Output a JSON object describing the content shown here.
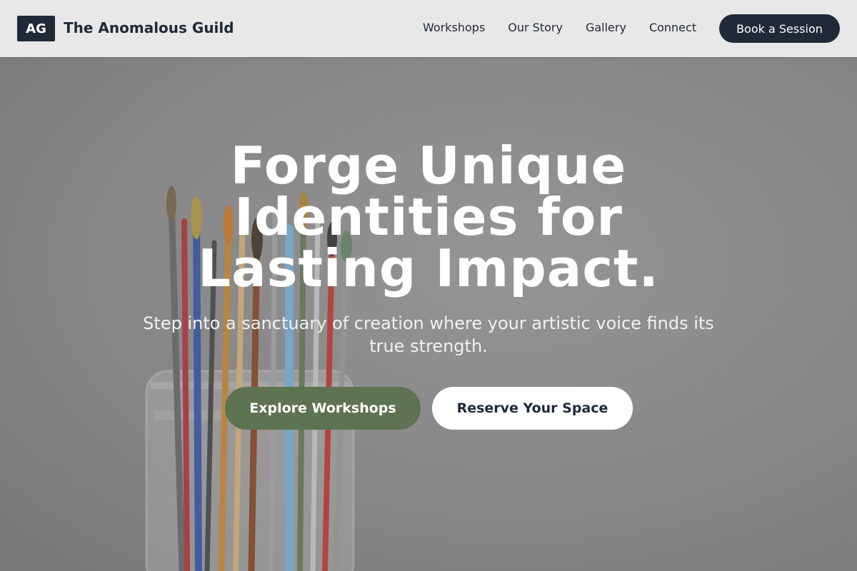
{
  "header": {
    "logo_text": "AG",
    "brand_name": "The Anomalous Guild",
    "nav": [
      {
        "label": "Workshops"
      },
      {
        "label": "Our Story"
      },
      {
        "label": "Gallery"
      },
      {
        "label": "Connect"
      }
    ],
    "cta_label": "Book a Session"
  },
  "hero": {
    "title_lines": [
      "Forge Unique",
      "Identities for",
      "Lasting Impact."
    ],
    "subtitle": "Step into a sanctuary of creation where your artistic voice finds its true strength.",
    "primary_button": "Explore Workshops",
    "secondary_button": "Reserve Your Space",
    "background_image": "paintbrushes-in-glass-jar"
  },
  "colors": {
    "header_bg": "#e8e8e8",
    "brand_dark": "#1f2937",
    "accent_green": "#5d7351",
    "white": "#ffffff"
  }
}
